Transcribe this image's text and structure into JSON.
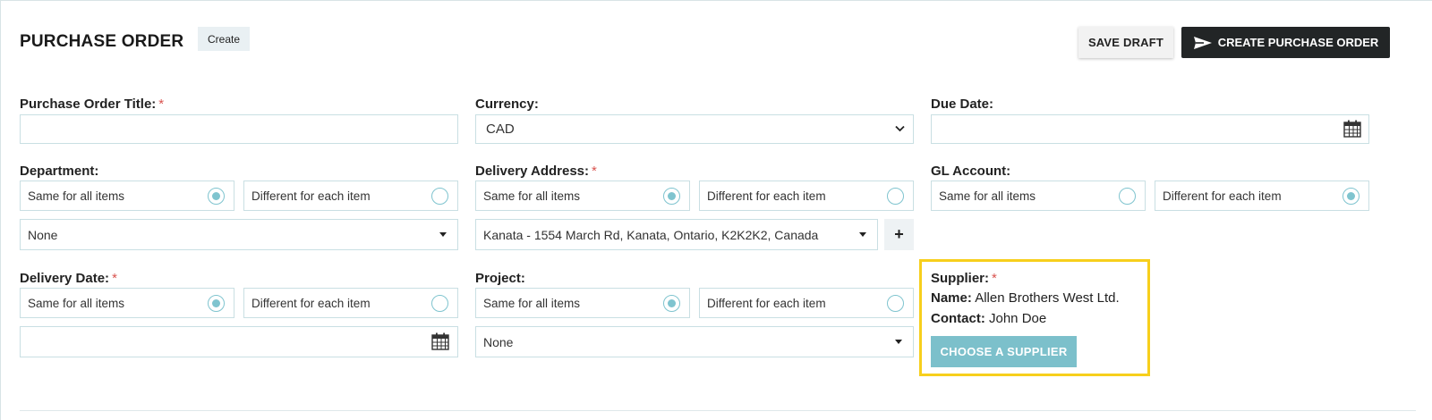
{
  "header": {
    "title": "PURCHASE ORDER",
    "status_badge": "Create",
    "save_draft_label": "SAVE DRAFT",
    "create_label": "CREATE PURCHASE ORDER"
  },
  "form": {
    "title_field": {
      "label": "Purchase Order Title:",
      "required_mark": "*",
      "value": ""
    },
    "currency": {
      "label": "Currency:",
      "selected": "CAD"
    },
    "due_date": {
      "label": "Due Date:",
      "value": ""
    },
    "department": {
      "label": "Department:",
      "option_same": "Same for all items",
      "option_different": "Different for each item",
      "selected_mode": "same",
      "value": "None"
    },
    "delivery_address": {
      "label": "Delivery Address:",
      "required_mark": "*",
      "option_same": "Same for all items",
      "option_different": "Different for each item",
      "selected_mode": "same",
      "value": "Kanata - 1554 March Rd, Kanata, Ontario, K2K2K2, Canada",
      "add_label": "+"
    },
    "gl_account": {
      "label": "GL Account:",
      "option_same": "Same for all items",
      "option_different": "Different for each item",
      "selected_mode": "different"
    },
    "delivery_date": {
      "label": "Delivery Date:",
      "required_mark": "*",
      "option_same": "Same for all items",
      "option_different": "Different for each item",
      "selected_mode": "same",
      "value": ""
    },
    "project": {
      "label": "Project:",
      "option_same": "Same for all items",
      "option_different": "Different for each item",
      "selected_mode": "same",
      "value": "None"
    },
    "supplier": {
      "label": "Supplier:",
      "required_mark": "*",
      "name_label": "Name:",
      "name": "Allen Brothers West Ltd.",
      "contact_label": "Contact:",
      "contact": "John Doe",
      "choose_label": "CHOOSE A SUPPLIER",
      "highlight_color": "#f7cf1c"
    }
  },
  "colors": {
    "accent": "#7cc0cb",
    "primary_button": "#222526",
    "required": "#d9534f"
  },
  "icons": {
    "send": "send-icon",
    "calendar": "calendar-icon",
    "chevron": "chevron-down-icon",
    "caret": "caret-down-icon"
  }
}
